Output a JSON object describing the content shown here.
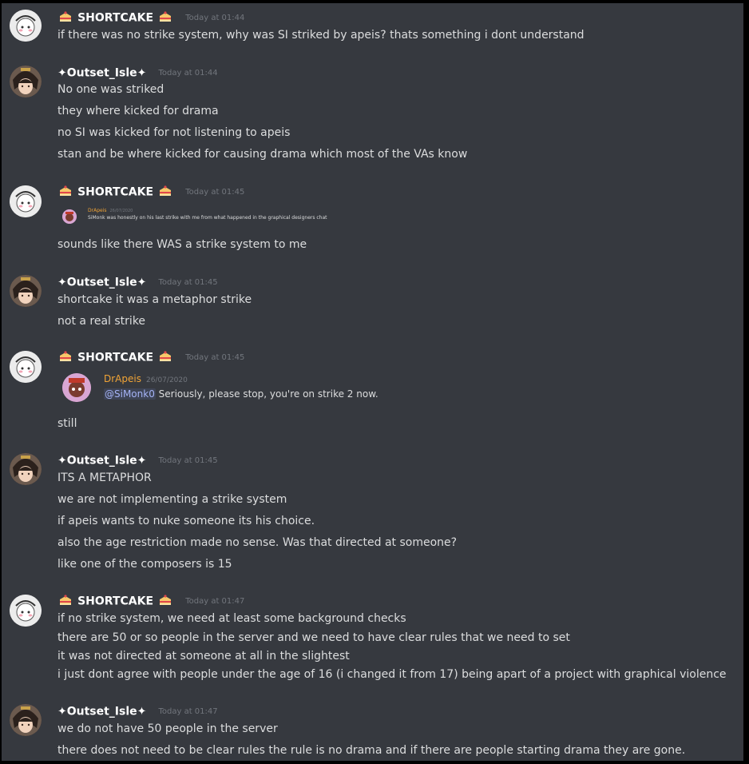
{
  "messages": [
    {
      "author": "SHORTCAKE",
      "time": "Today at 01:44",
      "lines": [
        "if there was no strike system, why was SI striked by apeis? thats something i dont understand"
      ]
    },
    {
      "author": "✦Outset_Isle✦",
      "time": "Today at 01:44",
      "lines": [
        "No one was striked",
        "they where kicked for drama",
        "no SI was kicked for not listening to apeis",
        "stan and be where kicked for causing drama which most of the VAs know"
      ]
    },
    {
      "author": "SHORTCAKE",
      "time": "Today at 01:45",
      "embed": {
        "name": "DrApeis",
        "date": "26/07/2020",
        "text": "SiMonk was honestly on his last strike with me from what happened in the graphical designers chat"
      },
      "lines": [
        "sounds like there WAS a strike system to me"
      ]
    },
    {
      "author": "✦Outset_Isle✦",
      "time": "Today at 01:45",
      "lines": [
        "shortcake it was a metaphor strike",
        "not a real strike"
      ]
    },
    {
      "author": "SHORTCAKE",
      "time": "Today at 01:45",
      "embed": {
        "name": "DrApeis",
        "date": "26/07/2020",
        "mention": "@SiMonk0",
        "text": " Seriously, please stop, you're on strike 2 now."
      },
      "lines": [
        "still"
      ]
    },
    {
      "author": "✦Outset_Isle✦",
      "time": "Today at 01:45",
      "lines": [
        "ITS A METAPHOR",
        "we are not implementing a strike system",
        "if apeis wants to nuke someone its his choice.",
        "also the age restriction made no sense. Was that directed at someone?",
        "like one of the composers is 15"
      ]
    },
    {
      "author": "SHORTCAKE",
      "time": "Today at 01:47",
      "lines": [
        "if no strike system, we need at least some background checks",
        "there are 50 or so people in the server and we need to have clear rules that we need to set",
        "it was not directed at someone at all in the slightest",
        "i just dont agree with people under the age of 16 (i changed it from 17) being apart of a project with graphical violence"
      ]
    },
    {
      "author": "✦Outset_Isle✦",
      "time": "Today at 01:47",
      "lines": [
        "we do not have 50 people in the server",
        "there does not need to be clear rules the rule is no drama and if there are people starting drama they are gone."
      ]
    }
  ]
}
